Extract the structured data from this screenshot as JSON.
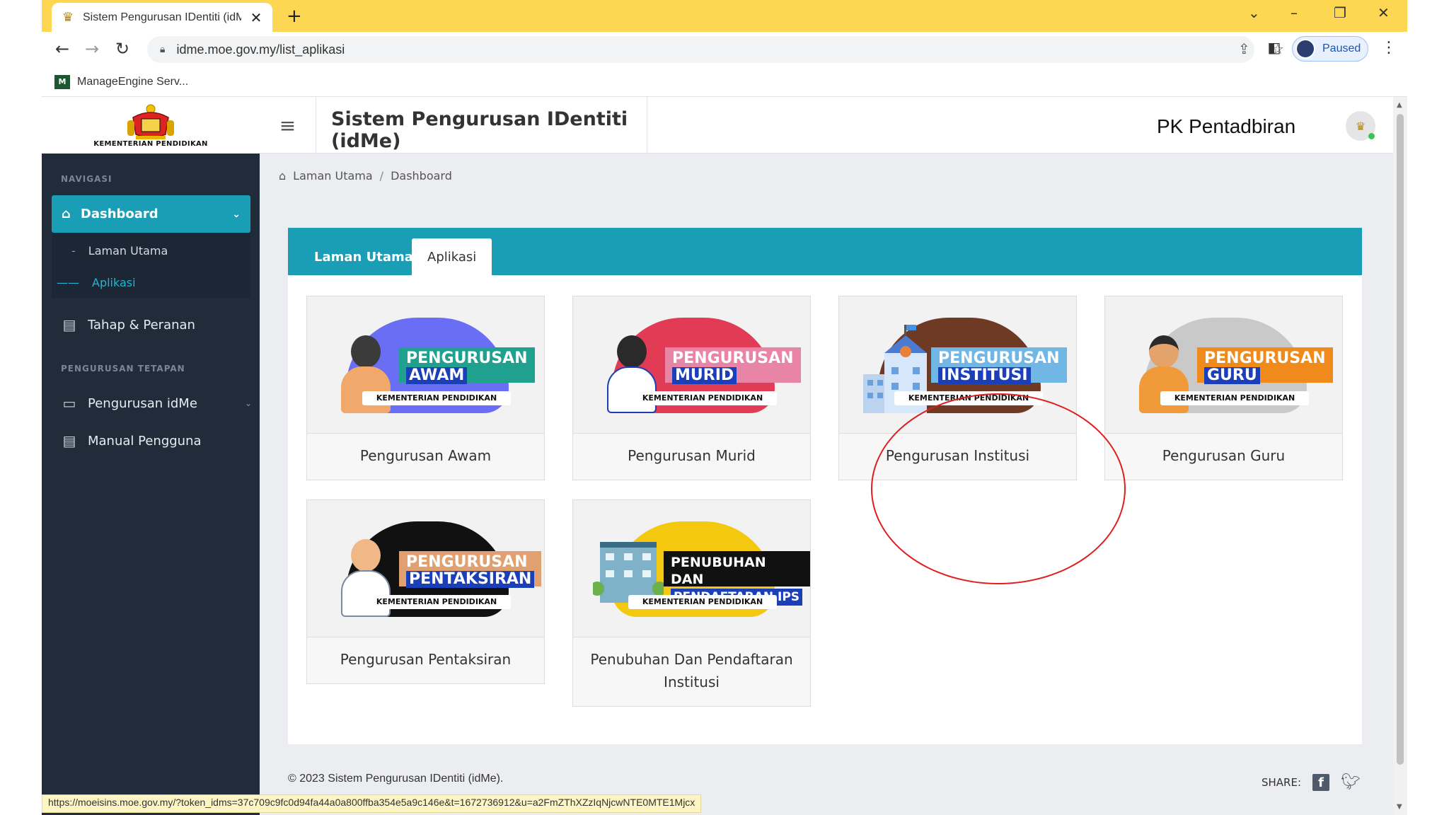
{
  "browser": {
    "tab_title": "Sistem Pengurusan IDentiti (idMe)",
    "url": "idme.moe.gov.my/list_aplikasi",
    "profile_label": "Paused",
    "bookmark": "ManageEngine Serv...",
    "status_url": "https://moeisins.moe.gov.my/?token_idms=37c709c9fc0d94fa44a0a800ffba354e5a9c146e&t=1672736912&u=a2FmZThXZzIqNjcwNTE0MTE1Mjcx"
  },
  "logo": {
    "text": "KEMENTERIAN PENDIDIKAN"
  },
  "sidebar": {
    "section1": "NAVIGASI",
    "dashboard": "Dashboard",
    "sub_items": [
      "Laman Utama",
      "Aplikasi"
    ],
    "tahap": "Tahap & Peranan",
    "section2": "PENGURUSAN TETAPAN",
    "pengurusan": "Pengurusan idMe",
    "manual": "Manual Pengguna"
  },
  "header": {
    "title": "Sistem Pengurusan IDentiti (idMe)",
    "user": "PK Pentadbiran"
  },
  "breadcrumb": {
    "home": "Laman Utama",
    "sep": "/",
    "current": "Dashboard"
  },
  "tabs": {
    "tab1": "Laman Utama",
    "tab2": "Aplikasi"
  },
  "apps": [
    {
      "label": "Pengurusan Awam",
      "line1": "PENGURUSAN",
      "line2": "AWAM",
      "ministry": "KEMENTERIAN PENDIDIKAN"
    },
    {
      "label": "Pengurusan Murid",
      "line1": "PENGURUSAN",
      "line2": "MURID",
      "ministry": "KEMENTERIAN PENDIDIKAN"
    },
    {
      "label": "Pengurusan Institusi",
      "line1": "PENGURUSAN",
      "line2": "INSTITUSI",
      "ministry": "KEMENTERIAN PENDIDIKAN"
    },
    {
      "label": "Pengurusan Guru",
      "line1": "PENGURUSAN",
      "line2": "GURU",
      "ministry": "KEMENTERIAN PENDIDIKAN"
    },
    {
      "label": "Pengurusan Pentaksiran",
      "line1": "PENGURUSAN",
      "line2": "PENTAKSIRAN",
      "ministry": "KEMENTERIAN PENDIDIKAN"
    },
    {
      "label": "Penubuhan Dan Pendaftaran Institusi",
      "line1": "PENUBUHAN DAN",
      "line2": "PENDAFTARAN IPS",
      "ministry": "KEMENTERIAN PENDIDIKAN"
    }
  ],
  "footer": {
    "copyright": "© 2023 Sistem Pengurusan IDentiti (idMe).",
    "share": "SHARE:"
  },
  "colors": {
    "accent": "#1a9eb5",
    "sidebar": "#212c3a",
    "browser_frame": "#fdd751",
    "highlight_circle": "#e01e1e"
  }
}
